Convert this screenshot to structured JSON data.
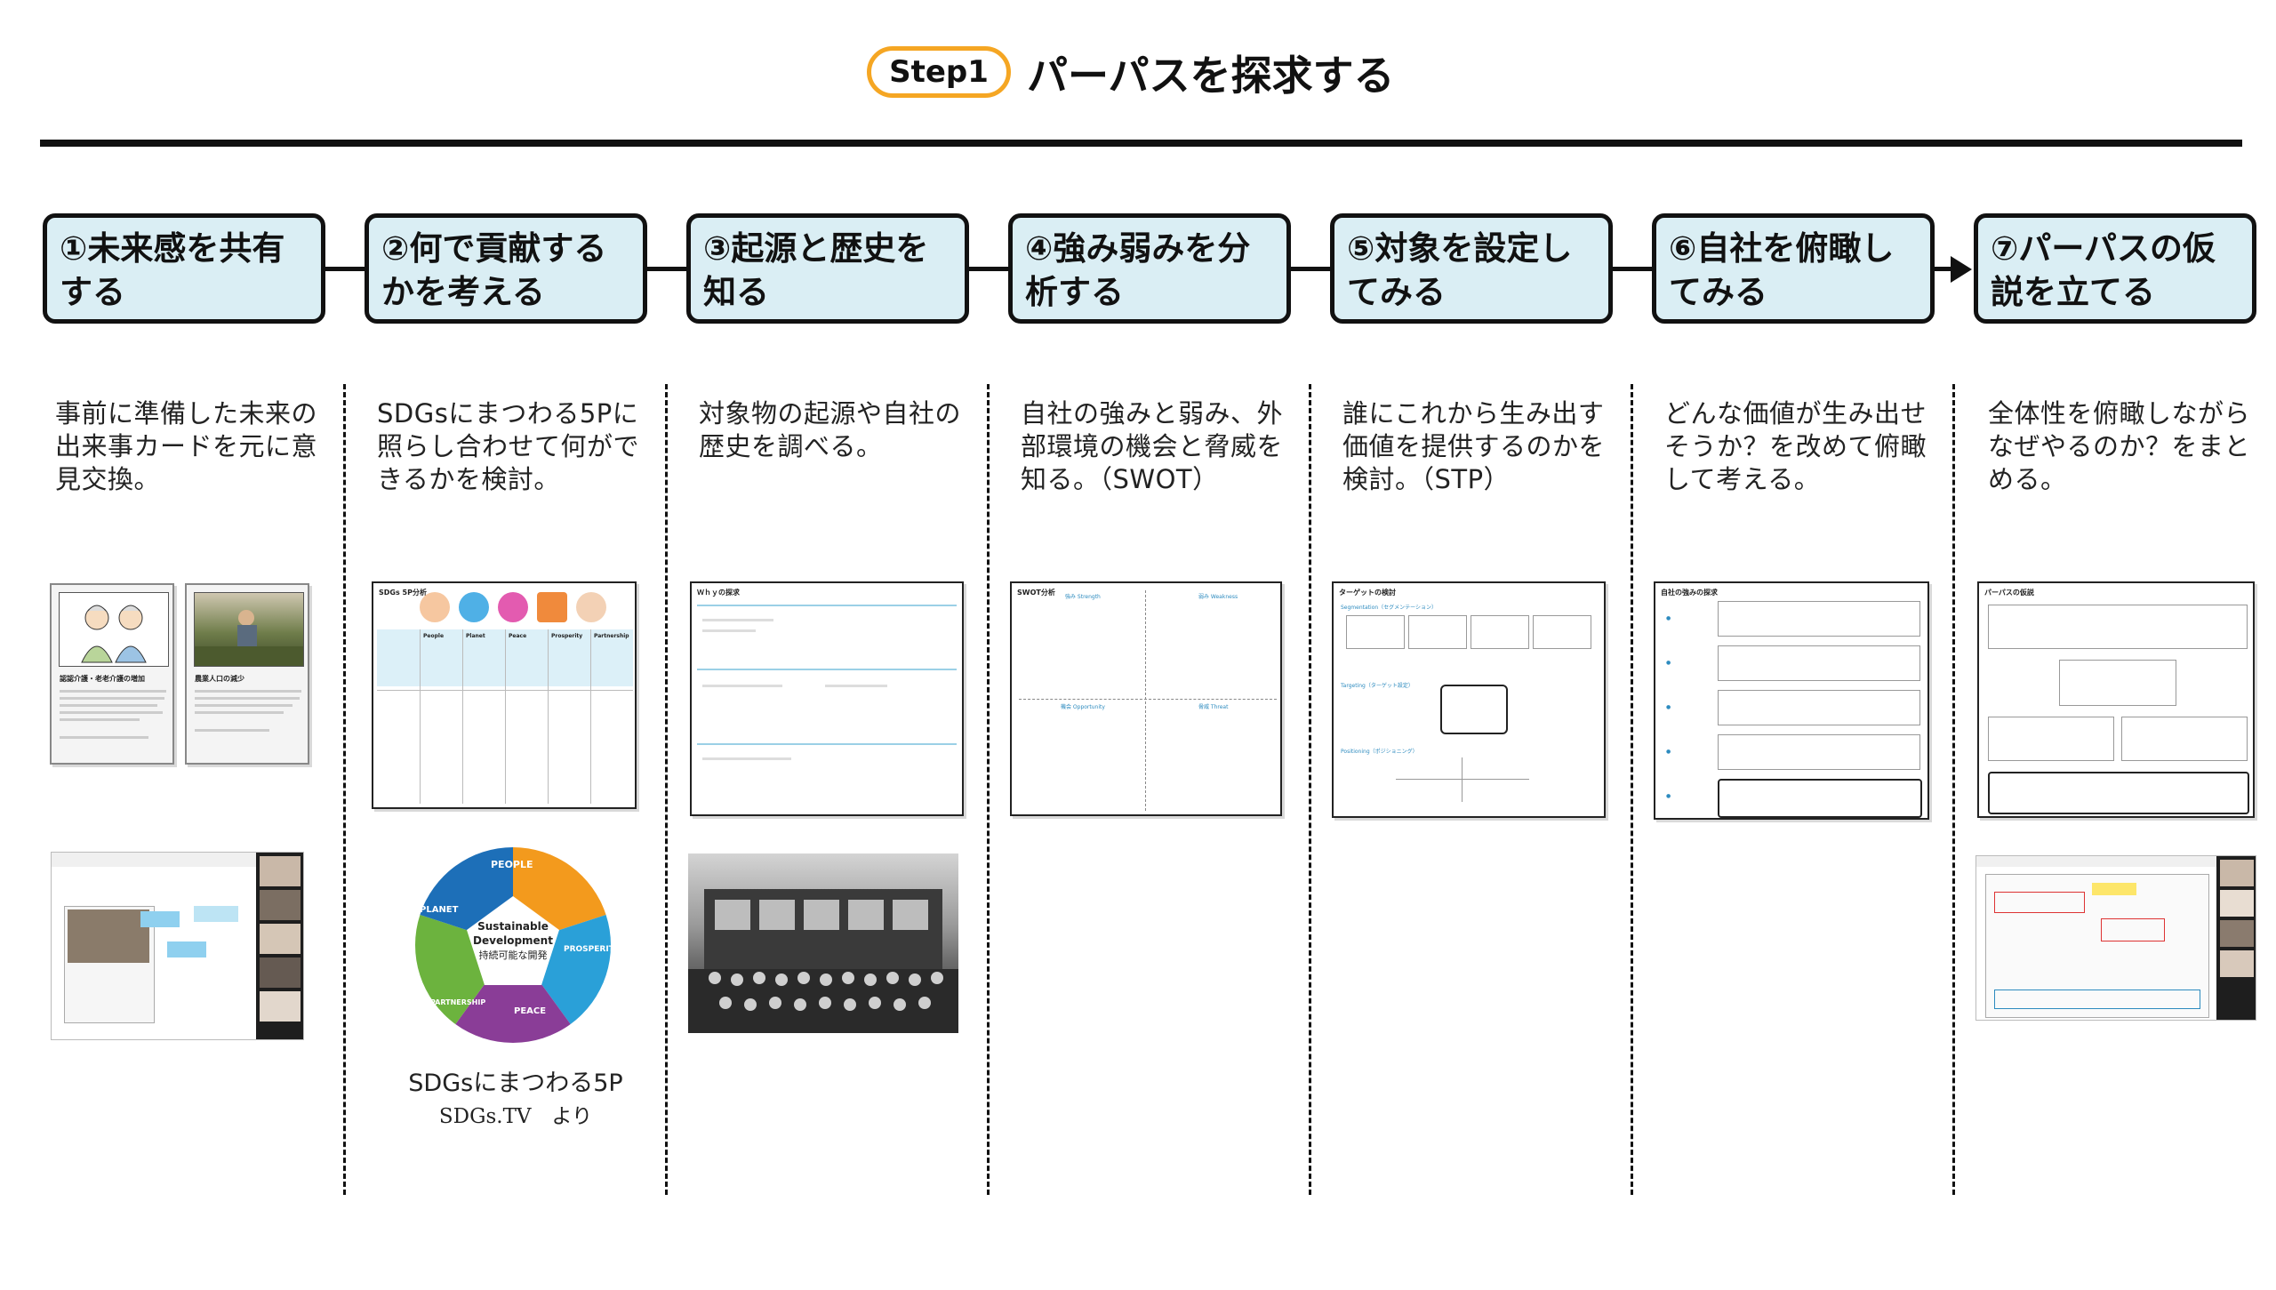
{
  "header": {
    "step_badge": "Step1",
    "title": "パーパスを探求する"
  },
  "steps": [
    {
      "label": "①未来感を共有する",
      "description": "事前に準備した未来の出来事カードを元に意見交換。"
    },
    {
      "label": "②何で貢献するかを考える",
      "description": "SDGsにまつわる5Pに照らし合わせて何ができるかを検討。"
    },
    {
      "label": "③起源と歴史を知る",
      "description": "対象物の起源や自社の歴史を調べる。"
    },
    {
      "label": "④強み弱みを分析する",
      "description": "自社の強みと弱み、外部環境の機会と脅威を知る。（SWOT）"
    },
    {
      "label": "⑤対象を設定してみる",
      "description": "誰にこれから生み出す価値を提供するのかを検討。（STP）"
    },
    {
      "label": "⑥自社を俯瞰してみる",
      "description": "どんな価値が生み出せそうか？を改めて俯瞰して考える。"
    },
    {
      "label": "⑦パーパスの仮説を立てる",
      "description": "全体性を俯瞰しながらなぜやるのか？をまとめる。"
    }
  ],
  "cards": [
    {
      "title": "認認介護・老老介護の増加"
    },
    {
      "title": "農業人口の減少"
    }
  ],
  "worksheets": {
    "sdgs": {
      "title": "SDGs 5P分析",
      "columns": [
        "People",
        "Planet",
        "Peace",
        "Prosperity",
        "Partnership"
      ]
    },
    "why": {
      "title": "Ｗｈｙの探求"
    },
    "swot": {
      "title": "SWOT分析",
      "quadrants": [
        "強み Strength",
        "弱み Weakness",
        "機会 Opportunity",
        "脅威 Threat"
      ]
    },
    "target": {
      "title": "ターゲットの検討",
      "sections": [
        "Segmentation（セグメンテーション）",
        "Targeting（ターゲット設定）",
        "Positioning（ポジショニング）"
      ]
    },
    "self": {
      "title": "自社の強みの探求"
    },
    "purpose": {
      "title": "パーパスの仮説"
    }
  },
  "sdgs_wheel": {
    "center_line1": "Sustainable",
    "center_line2": "Development",
    "center_line3": "持続可能な開発",
    "segments": [
      "PEOPLE",
      "PROSPERITY",
      "PEACE",
      "PARTNERSHIP",
      "PLANET"
    ],
    "colors": [
      "#1d6fb8",
      "#f39a1d",
      "#2aa0d8",
      "#8a3d97",
      "#6cb33e"
    ]
  },
  "caption": {
    "line1": "SDGsにまつわる5P",
    "line2": "SDGs.TV　より"
  }
}
